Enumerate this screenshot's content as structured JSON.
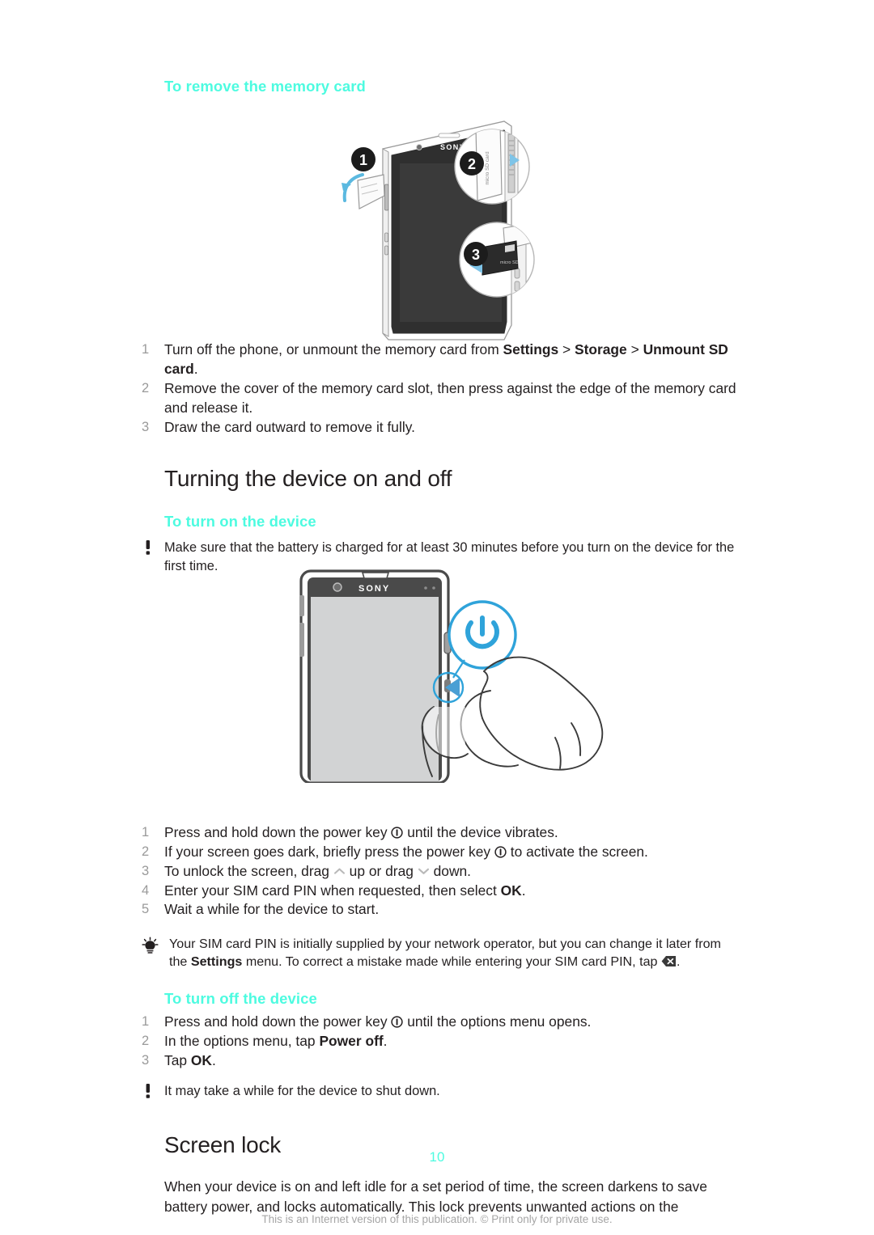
{
  "document": {
    "page_number": "10",
    "footnote": "This is an Internet version of this publication. © Print only for private use.",
    "accent_color": "#4DFBE0",
    "text_color": "#231F20",
    "muted_color": "#9A9A9A"
  },
  "sections": {
    "remove_memory_card": {
      "heading": "To remove the memory card",
      "figure": {
        "name": "memory-card-removal-diagram",
        "alt": "Sony Xperia phone showing memory card slot with three numbered callouts",
        "callouts": [
          "1",
          "2",
          "3"
        ],
        "card_label": "micro SD card"
      },
      "steps": [
        {
          "num": "1",
          "parts": [
            {
              "t": "Turn off the phone, or unmount the memory card from ",
              "b": false
            },
            {
              "t": "Settings",
              "b": true
            },
            {
              "t": " > ",
              "b": false
            },
            {
              "t": "Storage",
              "b": true
            },
            {
              "t": " > ",
              "b": false
            },
            {
              "t": "Unmount SD card",
              "b": true
            },
            {
              "t": ".",
              "b": false
            }
          ]
        },
        {
          "num": "2",
          "parts": [
            {
              "t": "Remove the cover of the memory card slot, then press against the edge of the memory card and release it.",
              "b": false
            }
          ]
        },
        {
          "num": "3",
          "parts": [
            {
              "t": "Draw the card outward to remove it fully.",
              "b": false
            }
          ]
        }
      ]
    },
    "turning_on_off": {
      "heading": "Turning the device on and off",
      "turn_on": {
        "heading": "To turn on the device",
        "note": {
          "icon": "exclamation-icon",
          "parts": [
            {
              "t": "Make sure that the battery is charged for at least 30 minutes before you turn on the device for the first time.",
              "b": false
            }
          ]
        },
        "figure": {
          "name": "power-key-press-diagram",
          "alt": "Hand pressing the power key on the side of a Sony Xperia phone, with a blue power symbol callout",
          "brand": "SONY",
          "callout_icon": "power-symbol"
        },
        "steps": [
          {
            "num": "1",
            "parts": [
              {
                "t": "Press and hold down the power key ",
                "b": false
              },
              {
                "icon": "power-key-icon"
              },
              {
                "t": " until the device vibrates.",
                "b": false
              }
            ]
          },
          {
            "num": "2",
            "parts": [
              {
                "t": "If your screen goes dark, briefly press the power key ",
                "b": false
              },
              {
                "icon": "power-key-icon"
              },
              {
                "t": " to activate the screen.",
                "b": false
              }
            ]
          },
          {
            "num": "3",
            "parts": [
              {
                "t": "To unlock the screen, drag ",
                "b": false
              },
              {
                "icon": "chevron-up-icon"
              },
              {
                "t": " up or drag ",
                "b": false
              },
              {
                "icon": "chevron-down-icon"
              },
              {
                "t": " down.",
                "b": false
              }
            ]
          },
          {
            "num": "4",
            "parts": [
              {
                "t": "Enter your SIM card PIN when requested, then select ",
                "b": false
              },
              {
                "t": "OK",
                "b": true
              },
              {
                "t": ".",
                "b": false
              }
            ]
          },
          {
            "num": "5",
            "parts": [
              {
                "t": "Wait a while for the device to start.",
                "b": false
              }
            ]
          }
        ],
        "tip": {
          "icon": "lightbulb-icon",
          "parts": [
            {
              "t": "Your SIM card PIN is initially supplied by your network operator, but you can change it later from the ",
              "b": false
            },
            {
              "t": "Settings",
              "b": true
            },
            {
              "t": " menu. To correct a mistake made while entering your SIM card PIN, tap ",
              "b": false
            },
            {
              "icon": "backspace-icon"
            },
            {
              "t": ".",
              "b": false
            }
          ]
        }
      },
      "turn_off": {
        "heading": "To turn off the device",
        "steps": [
          {
            "num": "1",
            "parts": [
              {
                "t": "Press and hold down the power key ",
                "b": false
              },
              {
                "icon": "power-key-icon"
              },
              {
                "t": " until the options menu opens.",
                "b": false
              }
            ]
          },
          {
            "num": "2",
            "parts": [
              {
                "t": "In the options menu, tap ",
                "b": false
              },
              {
                "t": "Power off",
                "b": true
              },
              {
                "t": ".",
                "b": false
              }
            ]
          },
          {
            "num": "3",
            "parts": [
              {
                "t": "Tap ",
                "b": false
              },
              {
                "t": "OK",
                "b": true
              },
              {
                "t": ".",
                "b": false
              }
            ]
          }
        ],
        "note": {
          "icon": "exclamation-icon",
          "parts": [
            {
              "t": "It may take a while for the device to shut down.",
              "b": false
            }
          ]
        }
      }
    },
    "screen_lock": {
      "heading": "Screen lock",
      "paragraph": "When your device is on and left idle for a set period of time, the screen darkens to save battery power, and locks automatically. This lock prevents unwanted actions on the"
    }
  }
}
